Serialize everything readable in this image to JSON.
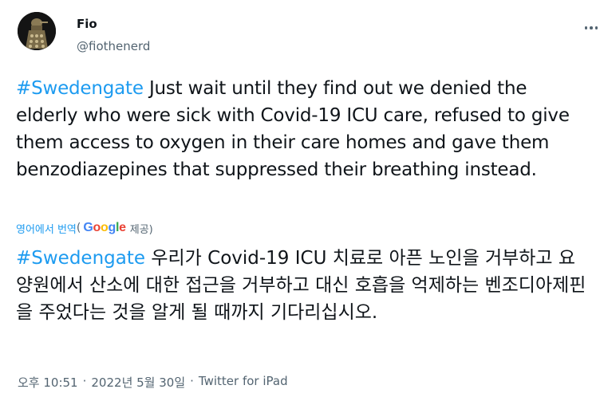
{
  "author": {
    "name": "Fio",
    "handle": "@fiothenerd"
  },
  "tweet": {
    "hashtag": "#Swedengate",
    "text": " Just wait until they find out we denied the elderly who were sick with Covid-19 ICU care, refused to give them access to oxygen in their care homes and gave them benzodiazepines that suppressed their breathing instead."
  },
  "translation": {
    "label": "영어에서 번역",
    "open_paren": "(",
    "google_letters": [
      "G",
      "o",
      "o",
      "g",
      "l",
      "e"
    ],
    "provided": "제공)",
    "hashtag": "#Swedengate",
    "text": " 우리가 Covid-19 ICU 치료로 아픈 노인을 거부하고 요양원에서 산소에 대한 접근을 거부하고 대신 호흡을 억제하는 벤조디아제핀을 주었다는 것을 알게 될 때까지 기다리십시오."
  },
  "meta": {
    "time": "오후 10:51",
    "separator": "·",
    "date": "2022년 5월 30일",
    "source": "Twitter for iPad"
  },
  "colors": {
    "link": "#1d9bf0",
    "muted": "#536471",
    "text": "#0f1419"
  },
  "icons": [
    "dalek-avatar",
    "more-icon"
  ]
}
